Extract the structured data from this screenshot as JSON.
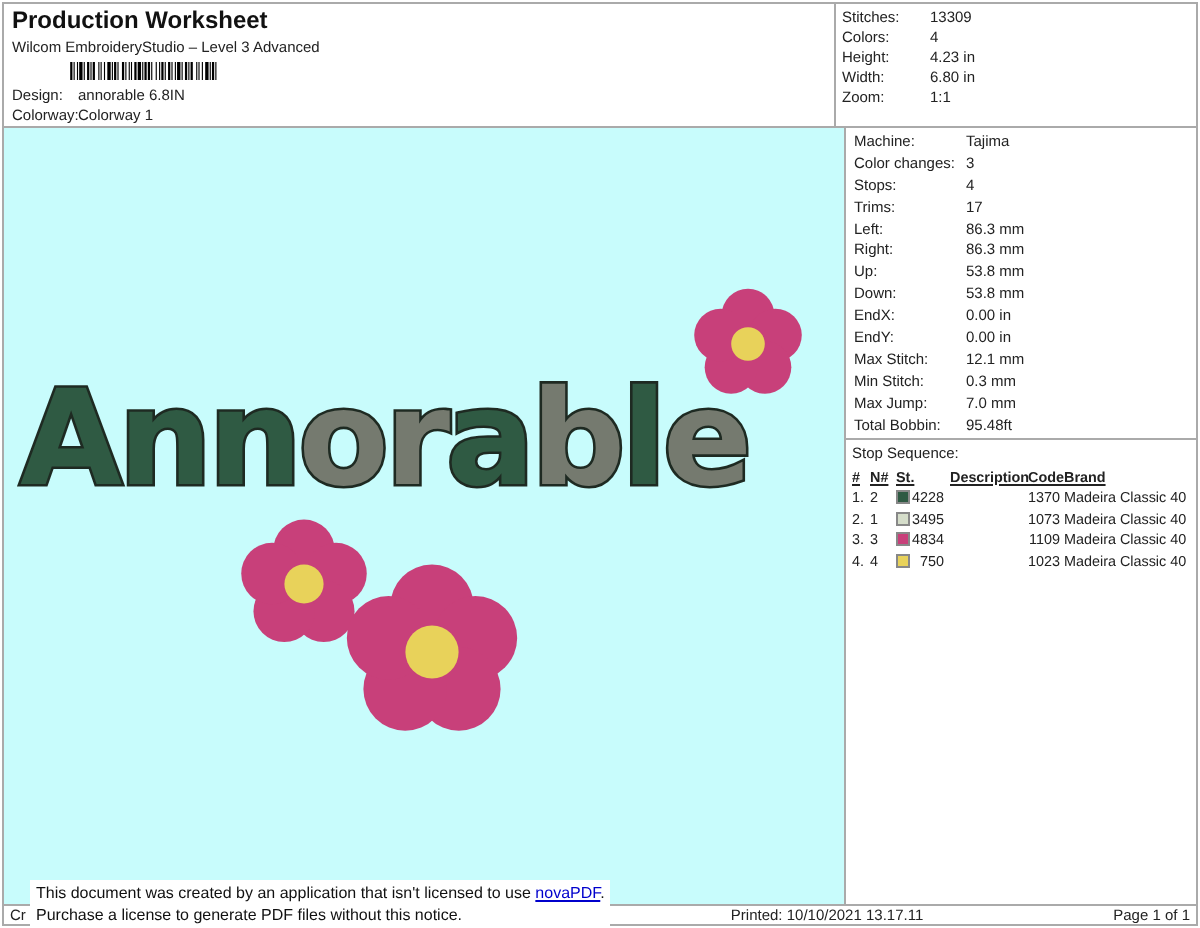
{
  "header": {
    "title": "Production Worksheet",
    "subtitle": "Wilcom EmbroideryStudio – Level 3 Advanced",
    "fields": [
      {
        "label": "Design:",
        "value": "annorable 6.8IN"
      },
      {
        "label": "Colorway:",
        "value": "Colorway 1"
      }
    ]
  },
  "summary": [
    {
      "label": "Stitches:",
      "value": "13309"
    },
    {
      "label": "Colors:",
      "value": "4"
    },
    {
      "label": "Height:",
      "value": "4.23 in"
    },
    {
      "label": "Width:",
      "value": "6.80 in"
    },
    {
      "label": "Zoom:",
      "value": "1:1"
    }
  ],
  "artwork": {
    "text": "Annorable"
  },
  "details": [
    {
      "label": "Machine:",
      "value": "Tajima"
    },
    {
      "label": "Color changes:",
      "value": "3"
    },
    {
      "label": "Stops:",
      "value": "4"
    },
    {
      "label": "Trims:",
      "value": "17"
    },
    {
      "label": "Left:",
      "value": "86.3 mm"
    },
    {
      "label": "Right:",
      "value": "86.3 mm"
    },
    {
      "label": "Up:",
      "value": "53.8 mm"
    },
    {
      "label": "Down:",
      "value": "53.8 mm"
    },
    {
      "label": "EndX:",
      "value": "0.00 in"
    },
    {
      "label": "EndY:",
      "value": "0.00 in"
    },
    {
      "label": "Max Stitch:",
      "value": "12.1 mm"
    },
    {
      "label": "Min Stitch:",
      "value": "0.3 mm"
    },
    {
      "label": "Max Jump:",
      "value": "7.0 mm"
    },
    {
      "label": "Total Bobbin:",
      "value": "95.48ft"
    }
  ],
  "stop_sequence": {
    "title": "Stop Sequence:",
    "columns": [
      "#",
      "N#",
      "St.",
      "Description",
      "Code",
      "Brand"
    ],
    "rows": [
      {
        "index": "1.",
        "n": "2",
        "color": "#2f5a43",
        "stitches": "4228",
        "code": "1370",
        "brand": "Madeira Classic 40"
      },
      {
        "index": "2.",
        "n": "1",
        "color": "#d5ddca",
        "stitches": "3495",
        "code": "1073",
        "brand": "Madeira Classic 40"
      },
      {
        "index": "3.",
        "n": "3",
        "color": "#c8407a",
        "stitches": "4834",
        "code": "1109",
        "brand": "Madeira Classic 40"
      },
      {
        "index": "4.",
        "n": "4",
        "color": "#e8d25a",
        "stitches": "750",
        "code": "1023",
        "brand": "Madeira Classic 40"
      }
    ]
  },
  "footer": {
    "left": "Cr",
    "printed": "Printed: 10/10/2021 13.17.11",
    "page": "Page 1 of 1"
  },
  "notice": {
    "text": "This document was created by an application that isn't licensed to use ",
    "link": "novaPDF",
    "end": ".",
    "line2": "Purchase a license to generate PDF files without this notice."
  }
}
